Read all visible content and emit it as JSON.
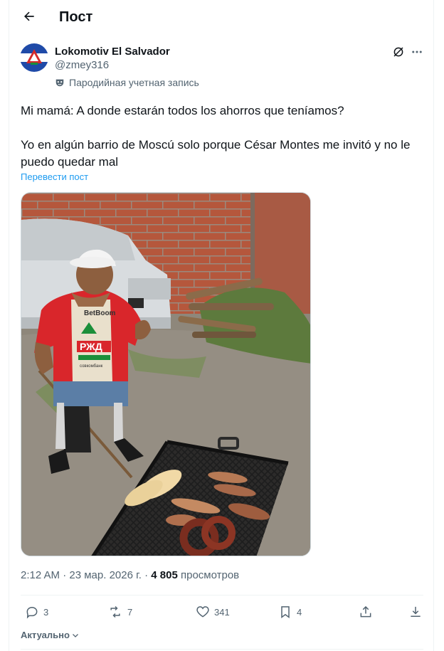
{
  "header": {
    "title": "Пост"
  },
  "author": {
    "name": "Lokomotiv El Salvador",
    "handle": "@zmey316",
    "parody_label": "Пародийная учетная запись"
  },
  "post": {
    "text": "Mi mamá: A donde estarán todos los ahorros que teníamos?\n\nYo en algún barrio de Moscú solo porque César Montes me invitó y no le puedo quedar mal",
    "translate_label": "Перевести пост"
  },
  "media": {
    "shirt_sponsor": "BetBoom",
    "shirt_logo": "РЖД",
    "shirt_bottom": "совкомбанк"
  },
  "meta": {
    "time": "2:12 AM",
    "separator": "·",
    "date": "23 мар. 2026 г.",
    "views_count": "4 805",
    "views_label": "просмотров"
  },
  "actions": {
    "replies": "3",
    "reposts": "7",
    "likes": "341",
    "bookmarks": "4"
  },
  "sort": {
    "label": "Актуально"
  },
  "colors": {
    "accent": "#1d9bf0",
    "secondary_text": "#536471"
  }
}
